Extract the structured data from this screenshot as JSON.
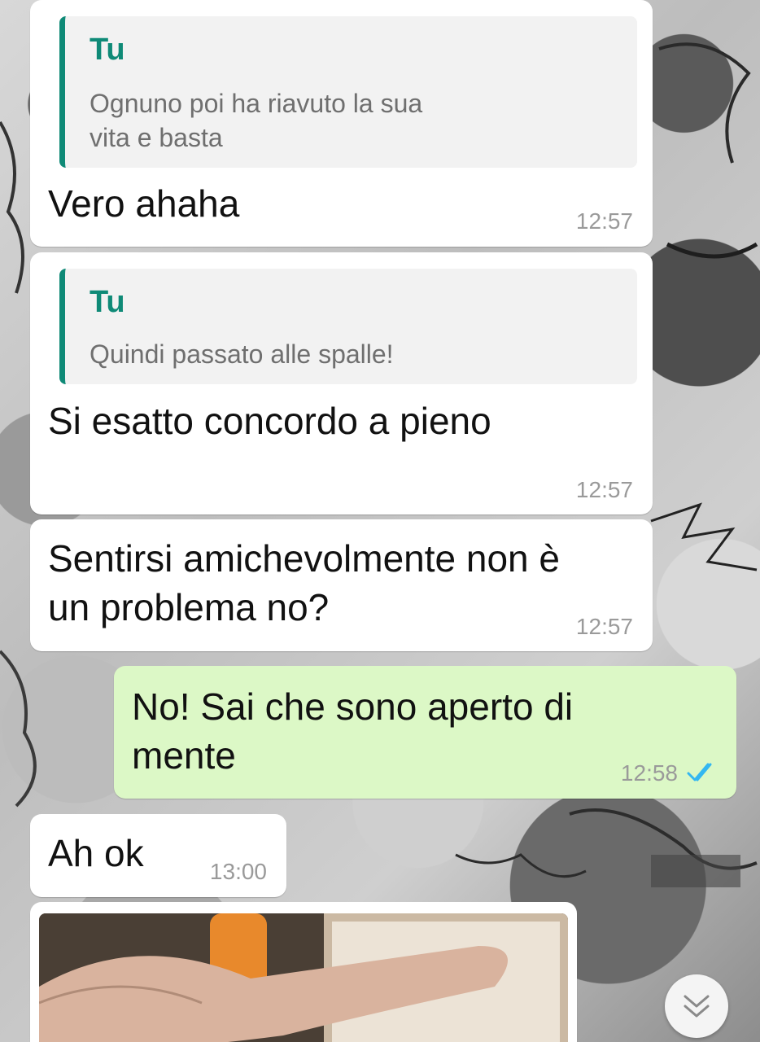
{
  "messages": [
    {
      "direction": "incoming",
      "quote": {
        "author": "Tu",
        "text": "Ognuno poi ha riavuto la sua\nvita e basta"
      },
      "text": "Vero ahaha",
      "time": "12:57"
    },
    {
      "direction": "incoming",
      "quote": {
        "author": "Tu",
        "text": "Quindi passato alle spalle!"
      },
      "text": "Si esatto concordo a pieno",
      "time": "12:57"
    },
    {
      "direction": "incoming",
      "text": "Sentirsi amichevolmente non è\nun problema no?",
      "time": "12:57"
    },
    {
      "direction": "outgoing",
      "text": "No! Sai che sono aperto di\nmente",
      "time": "12:58",
      "status": "read"
    },
    {
      "direction": "incoming",
      "text": "Ah ok",
      "time": "13:00"
    },
    {
      "direction": "incoming",
      "type": "image",
      "image_content": "photo-of-hand-and-monitor"
    }
  ],
  "icons": {
    "read_receipt": "double-check-icon",
    "scroll_down": "chevron-down-icon"
  },
  "colors": {
    "incoming_bubble": "#ffffff",
    "outgoing_bubble": "#dcf8c6",
    "quote_accent": "#0f8a77",
    "read_tick": "#34b7f1"
  }
}
